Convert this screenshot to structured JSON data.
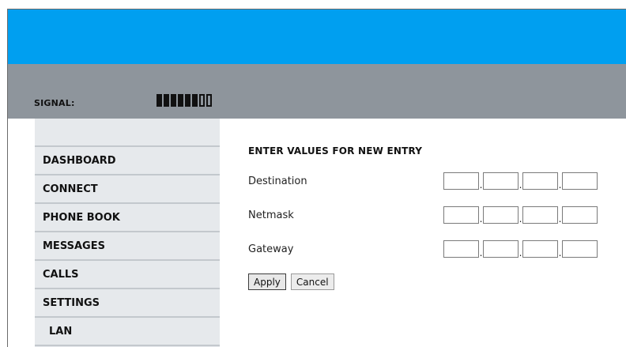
{
  "colors": {
    "banner": "#009ff0",
    "signal_bar": "#8e959c",
    "sidebar": "#e6e9ec"
  },
  "signal": {
    "label": "SIGNAL:",
    "level_filled": 6,
    "level_total": 8
  },
  "sidebar": {
    "items": [
      {
        "label": "DASHBOARD"
      },
      {
        "label": "CONNECT"
      },
      {
        "label": "PHONE BOOK"
      },
      {
        "label": "MESSAGES"
      },
      {
        "label": "CALLS"
      },
      {
        "label": "SETTINGS"
      },
      {
        "label": "LAN"
      }
    ]
  },
  "form": {
    "title": "ENTER VALUES FOR NEW ENTRY",
    "fields": [
      {
        "label": "Destination",
        "octets": [
          "",
          "",
          "",
          ""
        ]
      },
      {
        "label": "Netmask",
        "octets": [
          "",
          "",
          "",
          ""
        ]
      },
      {
        "label": "Gateway",
        "octets": [
          "",
          "",
          "",
          ""
        ]
      }
    ],
    "octet_separator": ".",
    "apply_label": "Apply",
    "cancel_label": "Cancel"
  }
}
